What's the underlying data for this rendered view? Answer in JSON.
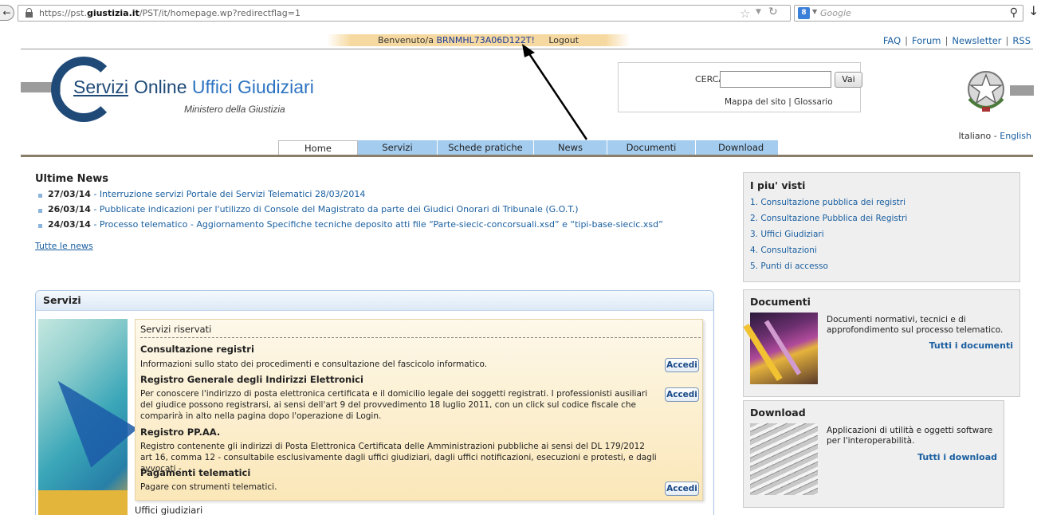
{
  "browser": {
    "url_prefix": "https://pst.",
    "url_domain": "giustizia.it",
    "url_path": "/PST/it/homepage.wp?redirectflag=1",
    "search_placeholder": "Google",
    "search_engine_badge": "8"
  },
  "header": {
    "welcome_prefix": "Benvenuto/a",
    "user_code": "BRNMHL73A06D122T!",
    "logout_label": "Logout",
    "top_links": [
      "FAQ",
      "Forum",
      "Newsletter",
      "RSS"
    ],
    "logo_servizi": "Servizi",
    "logo_online": " Online ",
    "logo_uffici": "Uffici Giudiziari",
    "logo_sub": "Ministero della Giustizia",
    "search_label": "CERCA",
    "search_value": "",
    "search_button": "Vai",
    "sitemap_label": "Mappa del sito",
    "glossary_label": "Glossario",
    "lang_it": "Italiano",
    "lang_en": "English"
  },
  "nav": {
    "tabs": [
      {
        "label": "Home"
      },
      {
        "label": "Servizi"
      },
      {
        "label": "Schede pratiche"
      },
      {
        "label": "News"
      },
      {
        "label": "Documenti"
      },
      {
        "label": "Download"
      }
    ]
  },
  "news": {
    "title": "Ultime News",
    "items": [
      {
        "date": "27/03/14",
        "text": " - Interruzione servizi Portale dei Servizi Telematici 28/03/2014"
      },
      {
        "date": "26/03/14",
        "text": " - Pubblicate indicazioni per l'utilizzo di Console del Magistrato da parte dei Giudici Onorari di Tribunale (G.O.T.)"
      },
      {
        "date": "24/03/14",
        "text": " - Processo telematico - Aggiornamento Specifiche tecniche deposito atti file “Parte-siecic-concorsuali.xsd” e “tipi-base-siecic.xsd”"
      }
    ],
    "all_link": "Tutte le news"
  },
  "servizi": {
    "title": "Servizi",
    "reserved_label": "Servizi riservati",
    "entries": [
      {
        "title": "Consultazione registri",
        "desc": "Informazioni sullo stato dei procedimenti e consultazione del fascicolo informatico.",
        "button": "Accedi"
      },
      {
        "title": "Registro Generale degli Indirizzi Elettronici",
        "desc": "Per conoscere l'indirizzo di posta elettronica certificata e il domicilio legale dei soggetti registrati. I professionisti ausiliari del giudice possono registrarsi, ai sensi dell'art 9 del provvedimento 18 luglio 2011, con un click sul codice fiscale che comparirà in alto nella pagina dopo l'operazione di Login.",
        "button": "Accedi"
      },
      {
        "title": "Registro PP.AA.",
        "desc": "Registro contenente gli indirizzi di Posta Elettronica Certificata delle Amministrazioni pubbliche ai sensi del DL 179/2012 art 16, comma 12 - consultabile esclusivamente dagli uffici giudiziari, dagli uffici notificazioni, esecuzioni e protesti, e dagli avvocati -"
      },
      {
        "title": "Pagamenti telematici",
        "desc": "Pagare con strumenti telematici.",
        "button": "Accedi"
      }
    ],
    "uffici_label": "Uffici giudiziari"
  },
  "sidebar": {
    "piu_visti_title": "I piu' visti",
    "piu_visti": [
      "1. Consultazione pubblica dei registri",
      "2. Consultazione Pubblica dei Registri",
      "3. Uffici Giudiziari",
      "4. Consultazioni",
      "5. Punti di accesso"
    ],
    "documenti_title": "Documenti",
    "documenti_desc": "Documenti normativi, tecnici e di approfondimento sul processo telematico.",
    "documenti_link": "Tutti i documenti",
    "download_title": "Download",
    "download_desc": "Applicazioni di utilità e oggetti software per l'interoperabilità.",
    "download_link": "Tutti i download"
  },
  "colors": {
    "brand_blue": "#1f4a78",
    "link_blue": "#1a5fa0",
    "nav_blue": "#a4ccef",
    "welcome_bar": "#f6d9a0"
  }
}
